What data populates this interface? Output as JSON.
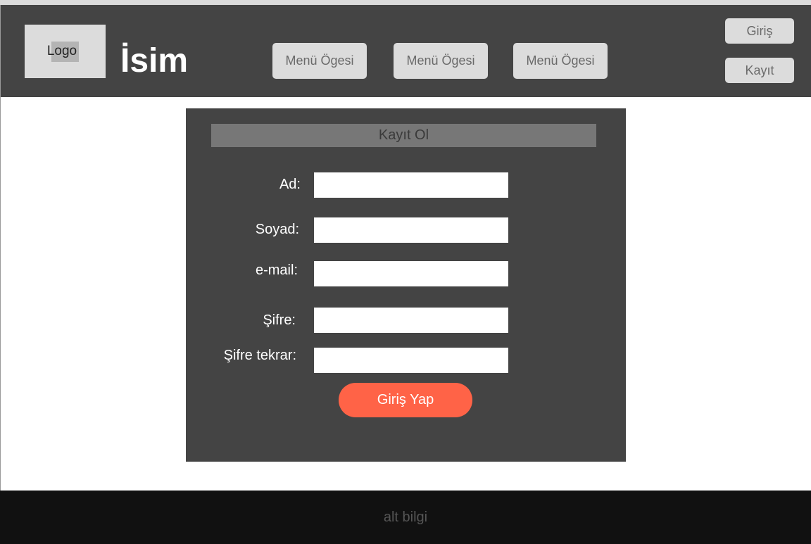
{
  "header": {
    "logo_label": "Logo",
    "site_name": "İsim",
    "menu": [
      {
        "label": "Menü Ögesi"
      },
      {
        "label": "Menü Ögesi"
      },
      {
        "label": "Menü Ögesi"
      }
    ],
    "login_label": "Giriş",
    "register_label": "Kayıt"
  },
  "form": {
    "title": "Kayıt Ol",
    "fields": [
      {
        "label": "Ad:",
        "value": ""
      },
      {
        "label": "Soyad:",
        "value": ""
      },
      {
        "label": "e-mail:",
        "value": ""
      },
      {
        "label": "Şifre:",
        "value": ""
      },
      {
        "label": "Şifre tekrar:",
        "value": ""
      }
    ],
    "submit_label": "Giriş Yap"
  },
  "footer": {
    "text": "alt bilgi"
  },
  "colors": {
    "header_bg": "#444444",
    "panel_bg": "#444444",
    "button_bg": "#dcdcdc",
    "accent": "#ff6347",
    "footer_bg": "#111111"
  }
}
